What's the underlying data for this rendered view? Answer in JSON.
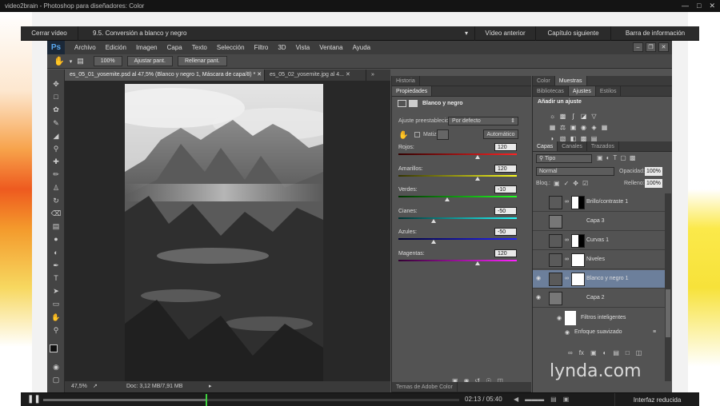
{
  "window": {
    "title": "video2brain - Photoshop para diseñadores: Color"
  },
  "player": {
    "close_label": "Cerrar vídeo",
    "chapter": "9.5. Conversión a blanco y negro",
    "prev_label": "Vídeo anterior",
    "next_label": "Capítulo siguiente",
    "info_label": "Barra de información",
    "time": "02:13 / 05:40",
    "reduce_label": "Interfaz reducida",
    "progress": 0.39
  },
  "menu": [
    "Archivo",
    "Edición",
    "Imagen",
    "Capa",
    "Texto",
    "Selección",
    "Filtro",
    "3D",
    "Vista",
    "Ventana",
    "Ayuda"
  ],
  "options": {
    "zoom_btn": "100%",
    "fit_btn": "Ajustar pant.",
    "fill_btn": "Rellenar pant."
  },
  "doc": {
    "tab1": "es_05_01_yosemite.psd al 47,5% (Blanco y negro 1, Máscara de capa/8) *",
    "tab2": "es_05_02_yosemite.jpg al 4...",
    "zoom": "47,5%",
    "doc_info": "Doc: 3,12 MB/7,91 MB"
  },
  "properties": {
    "tab_history": "Historia",
    "tab_props": "Propiedades",
    "title": "Blanco y negro",
    "preset_label": "Ajuste preestablecido:",
    "preset_value": "Por defecto",
    "tint_label": "Matiz",
    "auto_label": "Automático",
    "footer": "Temas de Adobe Color",
    "sliders": [
      {
        "label": "Rojos:",
        "value": "120",
        "pos": 0.67,
        "grad": "linear-gradient(90deg,#300,#f22)"
      },
      {
        "label": "Amarillos:",
        "value": "120",
        "pos": 0.67,
        "grad": "linear-gradient(90deg,#330,#ff2)"
      },
      {
        "label": "Verdes:",
        "value": "-10",
        "pos": 0.41,
        "grad": "linear-gradient(90deg,#030,#2f2)"
      },
      {
        "label": "Cianes:",
        "value": "-50",
        "pos": 0.3,
        "grad": "linear-gradient(90deg,#033,#2ff)"
      },
      {
        "label": "Azules:",
        "value": "-50",
        "pos": 0.3,
        "grad": "linear-gradient(90deg,#003,#22f)"
      },
      {
        "label": "Magentas:",
        "value": "120",
        "pos": 0.67,
        "grad": "linear-gradient(90deg,#303,#f2f)"
      }
    ]
  },
  "adjustments": {
    "tab_color": "Color",
    "tab_swatches": "Muestras",
    "tab_libs": "Bibliotecas",
    "tab_adj": "Ajustes",
    "tab_styles": "Estilos",
    "heading": "Añadir un ajuste"
  },
  "layers": {
    "tab_layers": "Capas",
    "tab_channels": "Canales",
    "tab_paths": "Trazados",
    "filter": "Tipo",
    "blend": "Normal",
    "opacity_label": "Opacidad:",
    "opacity": "100%",
    "lock_label": "Bloq.:",
    "fill_label": "Relleno:",
    "fill": "100%",
    "items": [
      {
        "name": "Brillo/contraste 1",
        "visible": false,
        "sel": false,
        "mask": true
      },
      {
        "name": "Capa 3",
        "visible": false,
        "sel": false,
        "mask": false
      },
      {
        "name": "Curvas 1",
        "visible": false,
        "sel": false,
        "mask": true
      },
      {
        "name": "Niveles",
        "visible": false,
        "sel": false,
        "mask": true
      },
      {
        "name": "Blanco y negro 1",
        "visible": true,
        "sel": true,
        "mask": true
      },
      {
        "name": "Capa 2",
        "visible": true,
        "sel": false,
        "mask": false
      }
    ],
    "smart_filters": "Filtros inteligentes",
    "smart_sharpen": "Enfoque suavizado"
  },
  "brand": {
    "watermark": "lynda.com"
  }
}
